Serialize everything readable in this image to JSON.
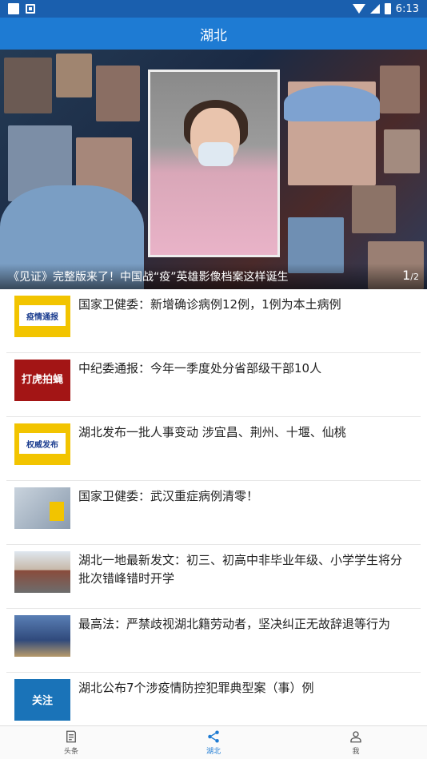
{
  "status": {
    "time": "6:13"
  },
  "app": {
    "title": "湖北"
  },
  "banner": {
    "caption": "《见证》完整版来了！中国战“疫”英雄影像档案这样诞生",
    "pager_current": "1",
    "pager_total": "/2"
  },
  "news": [
    {
      "title": "国家卫健委：新增确诊病例12例，1例为本土病例",
      "thumb_label": "疫情通报",
      "thumb_color": "#f2c400"
    },
    {
      "title": "中纪委通报：今年一季度处分省部级干部10人",
      "thumb_label": "打虎拍蝇",
      "thumb_color": "#a31515"
    },
    {
      "title": "湖北发布一批人事变动 涉宜昌、荆州、十堰、仙桃",
      "thumb_label": "权威发布",
      "thumb_color": "#f2c400"
    },
    {
      "title": "国家卫健委：武汉重症病例清零！",
      "thumb_label": "",
      "thumb_color": "#b9c2cc"
    },
    {
      "title": "湖北一地最新发文：初三、初高中非毕业年级、小学学生将分批次错峰错时开学",
      "thumb_label": "",
      "thumb_color": "#8d9aa7"
    },
    {
      "title": "最高法：严禁歧视湖北籍劳动者，坚决纠正无故辞退等行为",
      "thumb_label": "",
      "thumb_color": "#304a7c"
    },
    {
      "title": "湖北公布7个涉疫情防控犯罪典型案（事）例",
      "thumb_label": "关注",
      "thumb_color": "#1a73b8"
    }
  ],
  "tabs": [
    {
      "label": "头条",
      "icon": "news-icon"
    },
    {
      "label": "湖北",
      "icon": "share-icon"
    },
    {
      "label": "我",
      "icon": "user-icon"
    }
  ],
  "colors": {
    "accent": "#1e7bd3",
    "statusbar": "#1a5fae"
  }
}
